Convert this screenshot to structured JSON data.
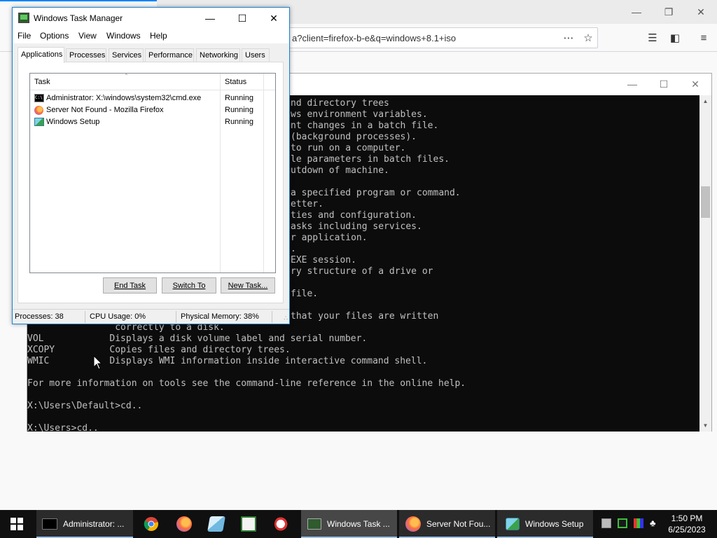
{
  "firefox": {
    "url_text": "a?client=firefox-b-e&q=windows+8.1+iso",
    "icons": [
      "more-icon",
      "bookmark-star-icon",
      "library-icon",
      "sidebar-icon",
      "menu-icon"
    ]
  },
  "cmd": {
    "lines": [
      {
        "text": "nd directory trees",
        "col": 47
      },
      {
        "text": "ws environment variables.",
        "col": 47
      },
      {
        "text": "nt changes in a batch file.",
        "col": 47
      },
      {
        "text": "(background processes).",
        "col": 47
      },
      {
        "text": "to run on a computer.",
        "col": 47
      },
      {
        "text": "le parameters in batch files.",
        "col": 47
      },
      {
        "text": "utdown of machine.",
        "col": 47
      },
      {
        "text": "",
        "col": 47
      },
      {
        "text": "a specified program or command.",
        "col": 47
      },
      {
        "text": "etter.",
        "col": 47
      },
      {
        "text": "ties and configuration.",
        "col": 47
      },
      {
        "text": "asks including services.",
        "col": 47
      },
      {
        "text": "r application.",
        "col": 47
      },
      {
        "text": ".",
        "col": 47
      },
      {
        "text": "EXE session.",
        "col": 47
      },
      {
        "text": "ry structure of a drive or",
        "col": 47
      },
      {
        "text": "",
        "col": 47
      },
      {
        "text": "file.",
        "col": 47
      },
      {
        "text": "",
        "col": 47
      },
      {
        "text": "that your files are written",
        "col": 47
      },
      {
        "text": "                correctly to a disk.",
        "col": 0
      },
      {
        "text": "VOL            Displays a disk volume label and serial number.",
        "col": 0
      },
      {
        "text": "XCOPY          Copies files and directory trees.",
        "col": 0
      },
      {
        "text": "WMIC           Displays WMI information inside interactive command shell.",
        "col": 0
      },
      {
        "text": "",
        "col": 0
      },
      {
        "text": "For more information on tools see the command-line reference in the online help.",
        "col": 0
      },
      {
        "text": "",
        "col": 0
      },
      {
        "text": "X:\\Users\\Default>cd..",
        "col": 0
      },
      {
        "text": "",
        "col": 0
      },
      {
        "text": "X:\\Users>cd..",
        "col": 0
      }
    ]
  },
  "taskmgr": {
    "title": "Windows Task Manager",
    "menu": [
      "File",
      "Options",
      "View",
      "Windows",
      "Help"
    ],
    "tabs": [
      "Applications",
      "Processes",
      "Services",
      "Performance",
      "Networking",
      "Users"
    ],
    "active_tab": "Applications",
    "columns": {
      "task": "Task",
      "status": "Status"
    },
    "rows": [
      {
        "task": "Administrator: X:\\windows\\system32\\cmd.exe",
        "status": "Running",
        "icon": "cmd-icon"
      },
      {
        "task": "Server Not Found - Mozilla Firefox",
        "status": "Running",
        "icon": "firefox-icon"
      },
      {
        "task": "Windows Setup",
        "status": "Running",
        "icon": "setup-icon"
      }
    ],
    "buttons": {
      "end_task": "End Task",
      "switch_to": "Switch To",
      "new_task": "New Task..."
    },
    "status": {
      "processes": "Processes: 38",
      "cpu": "CPU Usage: 0%",
      "memory": "Physical Memory: 38%"
    }
  },
  "taskbar": {
    "buttons": [
      {
        "label": "Administrator: ...",
        "icon": "cmd-icon"
      },
      {
        "label": "Windows Task ...",
        "icon": "task-manager-icon"
      },
      {
        "label": "Server Not Fou...",
        "icon": "firefox-icon"
      },
      {
        "label": "Windows Setup",
        "icon": "setup-icon"
      }
    ],
    "pinned": [
      "chrome-icon",
      "firefox-icon",
      "notepad-icon",
      "spreadsheet-icon",
      "paint-icon"
    ],
    "tray": [
      "network-error-icon",
      "green-app-icon",
      "color-app-icon",
      "volume-muted-icon"
    ],
    "clock": {
      "time": "1:50 PM",
      "date": "6/25/2023"
    }
  },
  "colors": {
    "taskbar": "#101010",
    "taskmgr_border": "#1883d7",
    "console_bg": "#0c0c0c",
    "console_text": "#c0c0c0"
  }
}
